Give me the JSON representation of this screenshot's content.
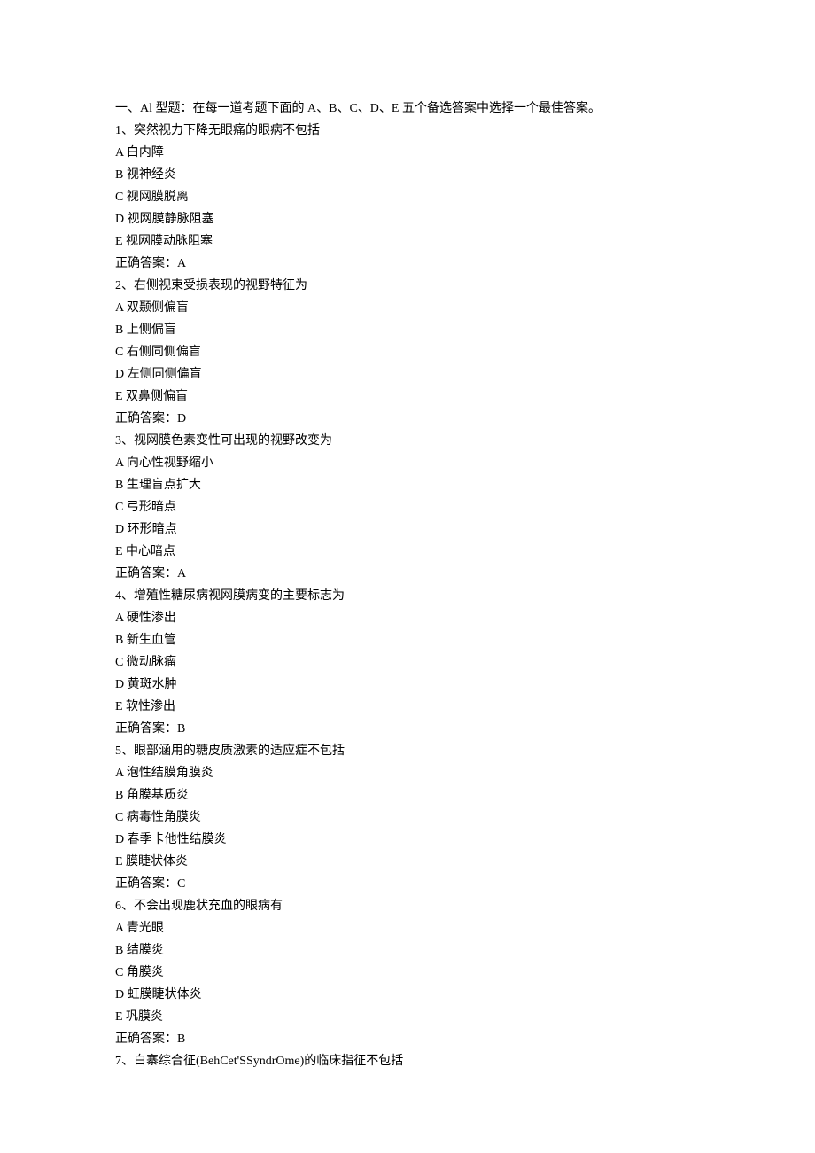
{
  "header": "一、Al 型题：在每一道考题下面的 A、B、C、D、E 五个备选答案中选择一个最佳答案。",
  "questions": [
    {
      "number": "1、",
      "stem": "突然视力下降无眼痛的眼病不包括",
      "options": [
        "A 白内障",
        "B 视神经炎",
        "C 视网膜脱离",
        "D 视网膜静脉阻塞",
        "E 视网膜动脉阻塞"
      ],
      "answer": "正确答案：A"
    },
    {
      "number": "2、",
      "stem": "右侧视束受损表现的视野特征为",
      "options": [
        "A 双颞侧偏盲",
        "B 上侧偏盲",
        "C 右侧同侧偏盲",
        "D 左侧同侧偏盲",
        "E 双鼻侧偏盲"
      ],
      "answer": "正确答案：D"
    },
    {
      "number": "3、",
      "stem": "视网膜色素变性可出现的视野改变为",
      "options": [
        "A 向心性视野缩小",
        "B 生理盲点扩大",
        "C 弓形暗点",
        "D 环形暗点",
        "E 中心暗点"
      ],
      "answer": "正确答案：A"
    },
    {
      "number": "4、",
      "stem": "增殖性糖尿病视网膜病变的主要标志为",
      "options": [
        "A 硬性渗出",
        "B 新生血管",
        "C 微动脉瘤",
        "D 黄斑水肿",
        "E 软性渗出"
      ],
      "answer": "正确答案：B"
    },
    {
      "number": "5、",
      "stem": "眼部涵用的糖皮质激素的适应症不包括",
      "options": [
        "A 泡性结膜角膜炎",
        "B 角膜基质炎",
        "C 病毒性角膜炎",
        "D 春季卡他性结膜炎",
        "E 膜睫状体炎"
      ],
      "answer": "正确答案：C"
    },
    {
      "number": "6、",
      "stem": "不会出现鹿状充血的眼病有",
      "options": [
        "A 青光眼",
        "B 结膜炎",
        "C 角膜炎",
        "D 虹膜睫状体炎",
        "E 巩膜炎"
      ],
      "answer": "正确答案：B"
    },
    {
      "number": "7、",
      "stem": "白寨综合征(BehCet'SSyndrOme)的临床指征不包括",
      "options": [],
      "answer": ""
    }
  ]
}
